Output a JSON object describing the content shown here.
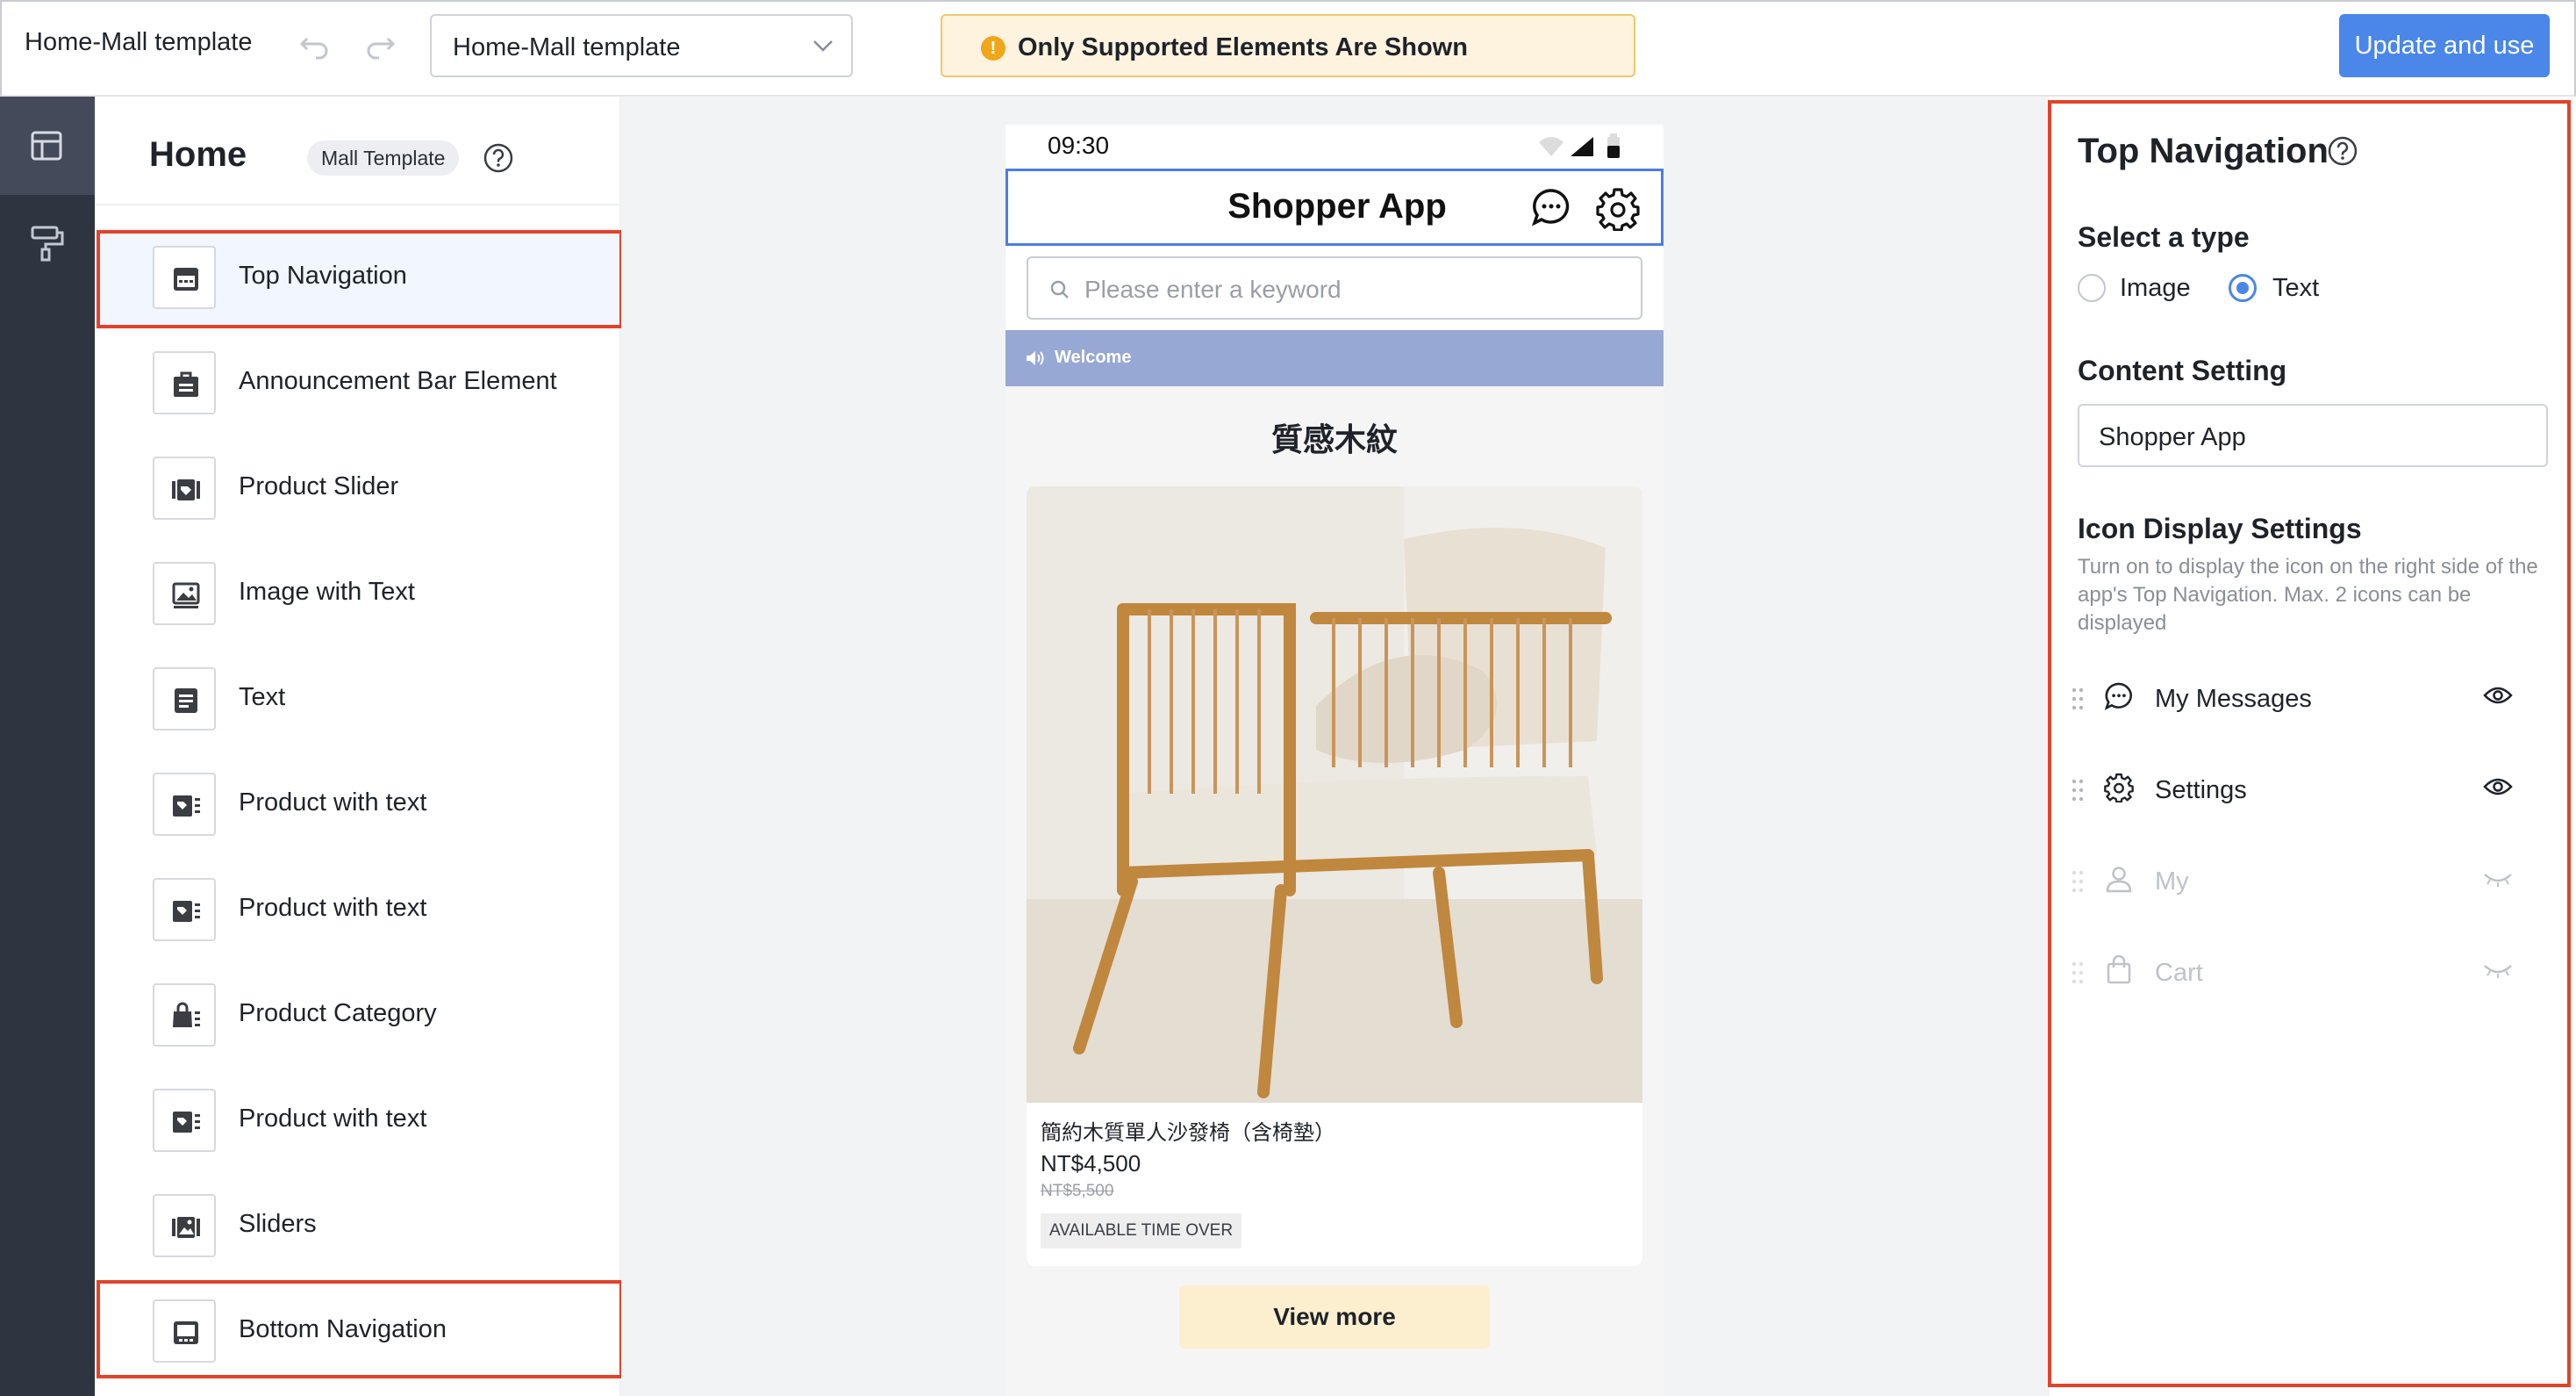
{
  "topbar": {
    "app_title": "Home-Mall template",
    "template_select": "Home-Mall template",
    "notice": "Only Supported Elements Are Shown",
    "update_label": "Update and use"
  },
  "element_list": {
    "title": "Home",
    "tag": "Mall Template",
    "items": [
      {
        "label": "Top Navigation",
        "icon": "top-navigation-icon",
        "selected": true
      },
      {
        "label": "Announcement Bar Element",
        "icon": "announcement-icon"
      },
      {
        "label": "Product Slider",
        "icon": "product-slider-icon"
      },
      {
        "label": "Image with Text",
        "icon": "image-icon"
      },
      {
        "label": "Text",
        "icon": "text-icon"
      },
      {
        "label": "Product with text",
        "icon": "product-tag-icon"
      },
      {
        "label": "Product with text",
        "icon": "product-tag-icon"
      },
      {
        "label": "Product Category",
        "icon": "product-category-icon"
      },
      {
        "label": "Product with text",
        "icon": "product-tag-icon"
      },
      {
        "label": "Sliders",
        "icon": "slider-images-icon"
      },
      {
        "label": "Bottom Navigation",
        "icon": "bottom-navigation-icon"
      }
    ]
  },
  "preview": {
    "time": "09:30",
    "app_name": "Shopper App",
    "search_placeholder": "Please enter a keyword",
    "announcement": "Welcome",
    "section_title": "質感木紋",
    "product": {
      "name": "簡約木質單人沙發椅（含椅墊）",
      "price": "NT$4,500",
      "old_price": "NT$5,500",
      "badge": "AVAILABLE TIME OVER"
    },
    "view_more": "View more"
  },
  "settings": {
    "title": "Top Navigation",
    "type_heading": "Select a type",
    "type_options": [
      "Image",
      "Text"
    ],
    "type_selected": "Text",
    "content_heading": "Content Setting",
    "content_value": "Shopper App",
    "icon_heading": "Icon Display Settings",
    "icon_desc": "Turn on to display the icon on the right side of the app's Top Navigation. Max. 2 icons can be displayed",
    "icons": [
      {
        "label": "My Messages",
        "icon": "message-icon",
        "visible": true
      },
      {
        "label": "Settings",
        "icon": "gear-icon",
        "visible": true
      },
      {
        "label": "My",
        "icon": "user-icon",
        "visible": false
      },
      {
        "label": "Cart",
        "icon": "bag-icon",
        "visible": false
      }
    ]
  },
  "colors": {
    "accent": "#4a87e8",
    "highlight": "#e2432b",
    "rail": "#2f3441",
    "announcement_bar": "#96a8d3",
    "view_more_bg": "#fbefcf"
  }
}
